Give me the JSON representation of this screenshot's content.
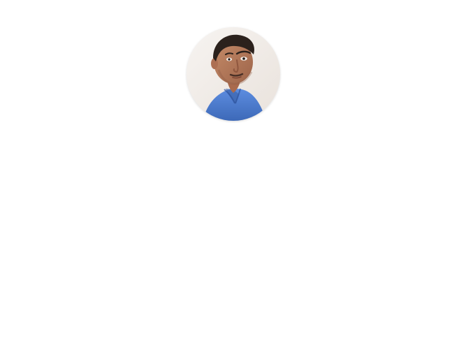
{
  "profile": {
    "avatar": {
      "description_icon": "profile-photo",
      "background_color": "#f2eeea",
      "shirt_color": "#4f7fcf",
      "skin_color": "#b97d5c",
      "hair_color": "#2b211c"
    }
  }
}
